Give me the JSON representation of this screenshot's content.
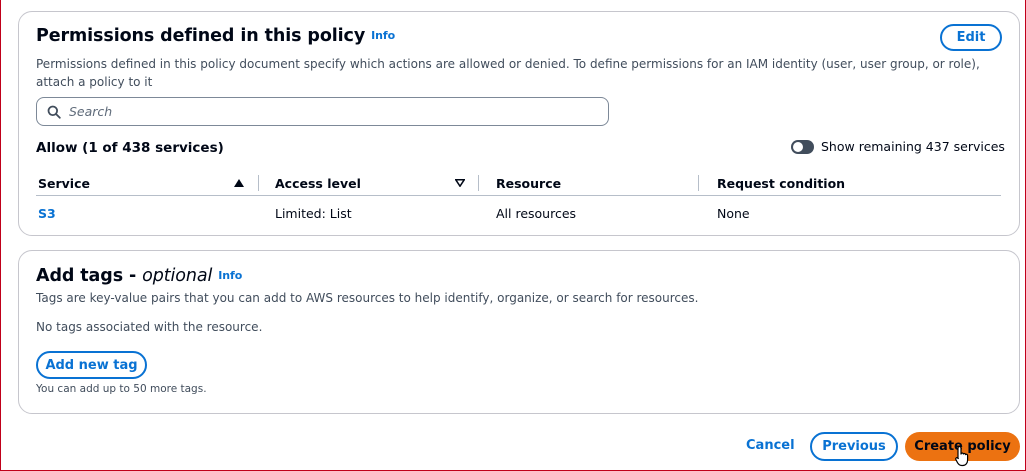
{
  "permissions": {
    "title": "Permissions defined in this policy",
    "info_label": "Info",
    "edit_label": "Edit",
    "description": "Permissions defined in this policy document specify which actions are allowed or denied. To define permissions for an IAM identity (user, user group, or role), attach a policy to it",
    "search": {
      "placeholder": "Search",
      "icon": "search-icon"
    },
    "allow_heading": "Allow (1 of 438 services)",
    "toggle": {
      "label": "Show remaining 437 services",
      "checked": false
    },
    "table": {
      "columns": [
        "Service",
        "Access level",
        "Resource",
        "Request condition"
      ],
      "rows": [
        {
          "service": "S3",
          "access_level": "Limited: List",
          "resource": "All resources",
          "request_condition": "None"
        }
      ],
      "sort_column": "Service",
      "sort_direction": "ascending"
    }
  },
  "tags": {
    "title_main": "Add tags - ",
    "title_optional": "optional",
    "info_label": "Info",
    "description": "Tags are key-value pairs that you can add to AWS resources to help identify, organize, or search for resources.",
    "empty_text": "No tags associated with the resource.",
    "add_button": "Add new tag",
    "limit_text": "You can add up to 50 more tags."
  },
  "footer": {
    "cancel_label": "Cancel",
    "previous_label": "Previous",
    "create_label": "Create policy"
  },
  "colors": {
    "link_blue": "#0972d3",
    "primary_orange": "#ec7211",
    "border_gray": "#c6c6cd",
    "frame_red": "#c0001a"
  }
}
